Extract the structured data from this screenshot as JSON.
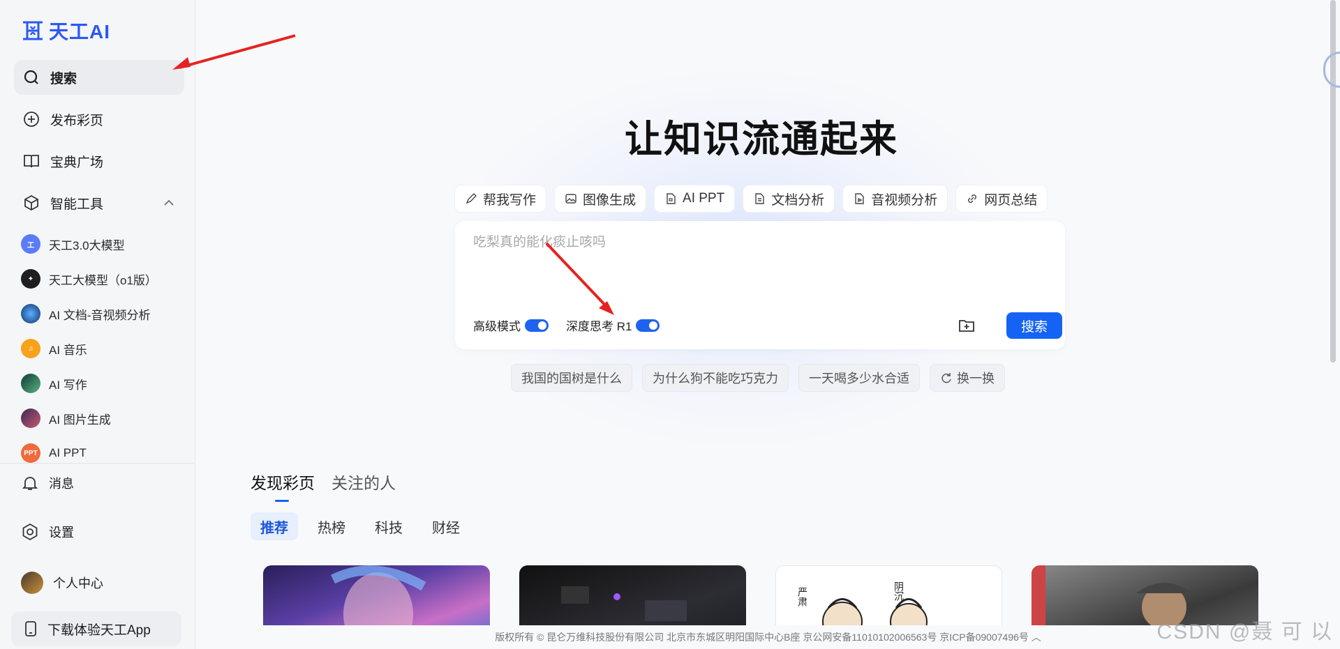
{
  "brand": {
    "name": "天工AI",
    "accent": "#1463f5"
  },
  "sidebar": {
    "nav": [
      {
        "label": "搜索",
        "icon": "search-icon"
      },
      {
        "label": "发布彩页",
        "icon": "plus-circle-icon"
      },
      {
        "label": "宝典广场",
        "icon": "book-icon"
      },
      {
        "label": "智能工具",
        "icon": "cube-icon"
      }
    ],
    "tools": [
      {
        "label": "天工3.0大模型",
        "icon": "tiangong-logo-icon"
      },
      {
        "label": "天工大模型（o1版）",
        "icon": "o1-logo-icon"
      },
      {
        "label": "AI 文档-音视频分析",
        "icon": "doc-analysis-avatar-icon"
      },
      {
        "label": "AI 音乐",
        "icon": "music-icon"
      },
      {
        "label": "AI 写作",
        "icon": "writing-avatar-icon"
      },
      {
        "label": "AI 图片生成",
        "icon": "image-gen-avatar-icon"
      },
      {
        "label": "AI PPT",
        "icon": "ppt-icon",
        "badge": "PPT"
      }
    ],
    "bottom": [
      {
        "label": "消息",
        "icon": "bell-icon"
      },
      {
        "label": "设置",
        "icon": "settings-icon"
      },
      {
        "label": "个人中心",
        "icon": "avatar"
      }
    ],
    "app_download": "下载体验天工App"
  },
  "hero": {
    "title": "让知识流通起来"
  },
  "tool_tabs": [
    {
      "label": "帮我写作",
      "icon": "pen-icon"
    },
    {
      "label": "图像生成",
      "icon": "image-icon"
    },
    {
      "label": "AI PPT",
      "icon": "ppt-doc-icon"
    },
    {
      "label": "文档分析",
      "icon": "document-icon"
    },
    {
      "label": "音视频分析",
      "icon": "audio-video-icon"
    },
    {
      "label": "网页总结",
      "icon": "link-icon"
    }
  ],
  "search": {
    "placeholder": "吃梨真的能化痰止咳吗",
    "mode_advanced": "高级模式",
    "mode_deep": "深度思考 R1",
    "button": "搜索"
  },
  "suggestions": [
    "我国的国树是什么",
    "为什么狗不能吃巧克力",
    "一天喝多少水合适"
  ],
  "refresh_label": "换一换",
  "feed": {
    "tabs": [
      "发现彩页",
      "关注的人"
    ],
    "categories": [
      "推荐",
      "热榜",
      "科技",
      "财经"
    ],
    "card3_labels": [
      "严肃",
      "阴沉"
    ]
  },
  "footer": "版权所有 © 昆仑万维科技股份有限公司 北京市东城区明阳国际中心B座 京公网安备11010102006563号 京ICP备09007496号",
  "watermark": "CSDN @聂 可 以"
}
